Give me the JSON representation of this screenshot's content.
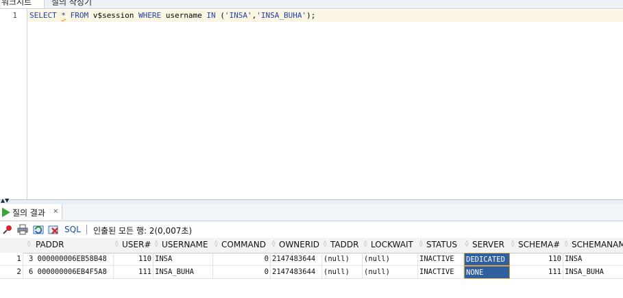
{
  "top_tabs": [
    "워크시트",
    "질의 작성기"
  ],
  "editor": {
    "line_number": "1",
    "sql": {
      "select": "SELECT",
      "star": "*",
      "from": "FROM",
      "table": "v$session",
      "where": "WHERE",
      "column": "username",
      "in": "IN",
      "open": "(",
      "str1": "'INSA'",
      "comma": ",",
      "str2": "'INSA_BUHA'",
      "close": ");"
    }
  },
  "result_tab": {
    "label": "질의 결과",
    "close": "×"
  },
  "toolbar": {
    "sql_label": "SQL",
    "separator": "|",
    "status": "인출된 모든 행: 2(0,007초)"
  },
  "icons": {
    "pin": "pin-icon",
    "print": "print-icon",
    "refresh": "refresh-icon",
    "delete": "delete-icon",
    "run": "play-icon"
  },
  "grid": {
    "columns": [
      "PADDR",
      "USER#",
      "USERNAME",
      "COMMAND",
      "OWNERID",
      "TADDR",
      "LOCKWAIT",
      "STATUS",
      "SERVER",
      "SCHEMA#",
      "SCHEMANAME"
    ],
    "rows": [
      {
        "num": "1",
        "paddr": "3 000000006EB58B48",
        "user": "110",
        "username": "INSA",
        "command": "0",
        "ownerid": "2147483644",
        "taddr": "(null)",
        "lockwait": "(null)",
        "status": "INACTIVE",
        "server": "DEDICATED",
        "schema": "110",
        "schemaname": "INSA"
      },
      {
        "num": "2",
        "paddr": "6 000000006EB4F5A8",
        "user": "111",
        "username": "INSA_BUHA",
        "command": "0",
        "ownerid": "2147483644",
        "taddr": "(null)",
        "lockwait": "(null)",
        "status": "INACTIVE",
        "server": "NONE",
        "schema": "111",
        "schemaname": "INSA_BUHA"
      }
    ]
  },
  "colors": {
    "selected_cell": "#2f5f9e",
    "keyword": "#1c3fa8",
    "highlight_line": "#fbf6e3"
  }
}
